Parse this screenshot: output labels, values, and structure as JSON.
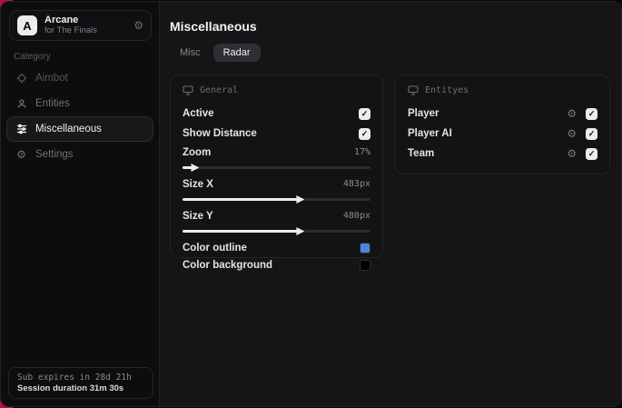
{
  "app": {
    "name": "Arcane",
    "subtitle": "for The Finals",
    "logo_letter": "A"
  },
  "icons": {
    "gear": "⚙",
    "check": "✓"
  },
  "colors": {
    "accent_red": "#b11240",
    "outline_blue": "#4d84d6",
    "background_swatch": "#000000"
  },
  "sidebar": {
    "category_label": "Category",
    "items": [
      {
        "label": "Aimbot",
        "icon": "crosshair-icon",
        "active": false
      },
      {
        "label": "Entities",
        "icon": "entities-icon",
        "active": false
      },
      {
        "label": "Miscellaneous",
        "icon": "sliders-icon",
        "active": true
      },
      {
        "label": "Settings",
        "icon": "gear-icon",
        "active": false
      }
    ],
    "footer": {
      "sub_line": "Sub expires in 28d 21h",
      "session_line": "Session duration 31m 30s"
    }
  },
  "main": {
    "title": "Miscellaneous",
    "tabs": [
      {
        "label": "Misc",
        "active": false
      },
      {
        "label": "Radar",
        "active": true
      }
    ],
    "general_panel": {
      "title": "General",
      "active": {
        "label": "Active",
        "checked": true
      },
      "show_distance": {
        "label": "Show Distance",
        "checked": true
      },
      "zoom": {
        "label": "Zoom",
        "value": "17%",
        "percent": 7
      },
      "size_x": {
        "label": "Size X",
        "value": "483px",
        "percent": 63
      },
      "size_y": {
        "label": "Size Y",
        "value": "480px",
        "percent": 63
      },
      "color_outline": {
        "label": "Color outline",
        "color": "#4d84d6"
      },
      "color_background": {
        "label": "Color background",
        "color": "#000000"
      }
    },
    "entities_panel": {
      "title": "Entityes",
      "rows": [
        {
          "label": "Player",
          "checked": true
        },
        {
          "label": "Player AI",
          "checked": true
        },
        {
          "label": "Team",
          "checked": true
        }
      ]
    }
  }
}
